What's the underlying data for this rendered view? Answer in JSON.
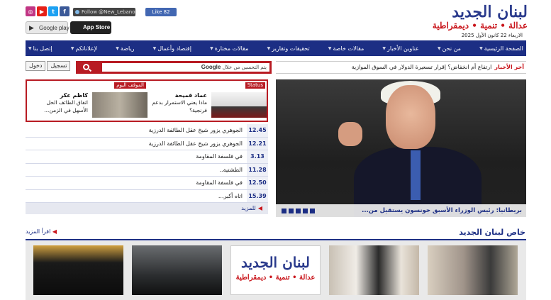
{
  "header": {
    "logo_title": "لبنان الجديد",
    "logo_tagline": "عدالة • تنمية • ديمقراطية",
    "date": "الاربعاء 22 كانون الأول 2025",
    "twitter_follow": "Follow @New_Lebanon",
    "fb_like": "Like 82",
    "google_play": "Google play",
    "app_store": "App Store",
    "social": [
      {
        "name": "instagram-icon",
        "glyph": "◎",
        "color": "#c13584"
      },
      {
        "name": "youtube-icon",
        "glyph": "▶",
        "color": "#e62117"
      },
      {
        "name": "twitter-icon",
        "glyph": "t",
        "color": "#1da1f2"
      },
      {
        "name": "facebook-icon",
        "glyph": "f",
        "color": "#3b5998"
      }
    ]
  },
  "nav": {
    "items": [
      "الصفحة الرئيسية",
      "من نحن",
      "عناوين الأخبار",
      "مقالات خاصة",
      "تحقيقات وتقارير",
      "مقالات مختارة",
      "إقتصاد وأعمال",
      "رياضة",
      "لإعلاناتكم",
      "إتصل بنا"
    ]
  },
  "auth": {
    "register": "تسجيل",
    "login": "دخول"
  },
  "search": {
    "google_label": "Google",
    "placeholder": "يتم التحسين من خلال"
  },
  "ticker": {
    "label": "آخر الأخبار",
    "headline": "ارتفاع أم انخفاض؟ إقرار تسعيرة الدولار في السوق الموازية"
  },
  "featured": [
    {
      "tag": "Status",
      "name": "عماد قميحة",
      "desc": "ماذا يعني الاستمرار بدعم فرنجية؟"
    },
    {
      "tag": "الموقف اليوم",
      "name": "كاظم عكر",
      "desc": "اتفاق الطائف الحل الأسهل في الزمن..."
    }
  ],
  "news_list": [
    {
      "time": "12.45",
      "title": "الجوهري يزور شيخ عقل الطائفة الدرزية"
    },
    {
      "time": "12.21",
      "title": "الجوهري يزور شيخ عقل الطائفة الدرزية"
    },
    {
      "time": "3.13",
      "title": "في فلسفة المقاومة"
    },
    {
      "time": "11.28",
      "title": "الطشتية.."
    },
    {
      "time": "12.50",
      "title": "في فلسفة المقاومة"
    },
    {
      "time": "15.39",
      "title": "اتاه أكبر..."
    }
  ],
  "news_more": "للمزيد",
  "main_story": {
    "caption": "بريطانيا: رئيس الوزراء الأسبق جونسون يستقيل من..."
  },
  "section": {
    "title": "خاص لبنان الجديد",
    "read_more": "اقرأ المزيد"
  }
}
